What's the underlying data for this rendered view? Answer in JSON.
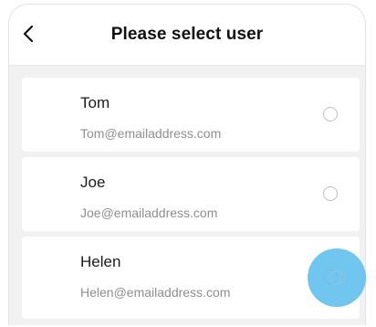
{
  "header": {
    "title": "Please select user",
    "back_icon": "chevron-left-icon"
  },
  "users": [
    {
      "name": "Tom",
      "email": "Tom@emailaddress.com",
      "selected": false
    },
    {
      "name": "Joe",
      "email": "Joe@emailaddress.com",
      "selected": false
    },
    {
      "name": "Helen",
      "email": "Helen@emailaddress.com",
      "selected": false
    }
  ],
  "colors": {
    "background": "#f1f1f2",
    "card": "#ffffff",
    "touch_indicator": "#5cbeec"
  }
}
